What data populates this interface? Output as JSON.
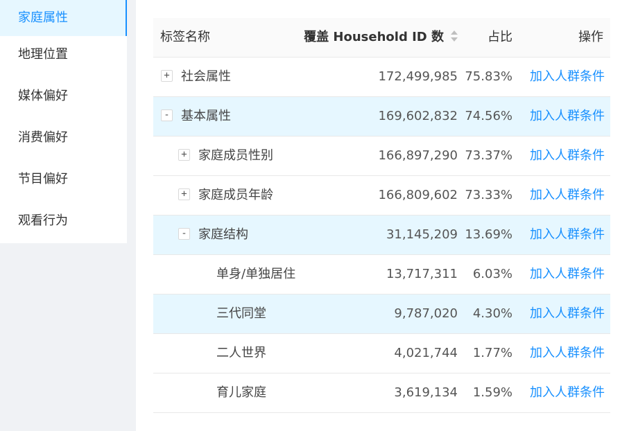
{
  "sidebar": {
    "items": [
      {
        "label": "家庭属性",
        "active": true
      },
      {
        "label": "地理位置"
      },
      {
        "label": "媒体偏好"
      },
      {
        "label": "消费偏好"
      },
      {
        "label": "节目偏好"
      },
      {
        "label": "观看行为"
      }
    ]
  },
  "table": {
    "headers": {
      "name": "标签名称",
      "count": "覆盖 Household ID 数",
      "pct": "占比",
      "op": "操作"
    },
    "rows": [
      {
        "expander": "+",
        "name": "社会属性",
        "count": "172,499,985",
        "pct": "75.83%",
        "op": "加入人群条件"
      },
      {
        "expander": "-",
        "name": "基本属性",
        "count": "169,602,832",
        "pct": "74.56%",
        "op": "加入人群条件"
      },
      {
        "expander": "+",
        "name": "家庭成员性别",
        "count": "166,897,290",
        "pct": "73.37%",
        "op": "加入人群条件"
      },
      {
        "expander": "+",
        "name": "家庭成员年龄",
        "count": "166,809,602",
        "pct": "73.33%",
        "op": "加入人群条件"
      },
      {
        "expander": "-",
        "name": "家庭结构",
        "count": "31,145,209",
        "pct": "13.69%",
        "op": "加入人群条件"
      },
      {
        "name": "单身/单独居住",
        "count": "13,717,311",
        "pct": "6.03%",
        "op": "加入人群条件"
      },
      {
        "name": "三代同堂",
        "count": "9,787,020",
        "pct": "4.30%",
        "op": "加入人群条件"
      },
      {
        "name": "二人世界",
        "count": "4,021,744",
        "pct": "1.77%",
        "op": "加入人群条件"
      },
      {
        "name": "育儿家庭",
        "count": "3,619,134",
        "pct": "1.59%",
        "op": "加入人群条件"
      }
    ]
  },
  "colors": {
    "accent": "#1890ff",
    "highlight_row": "#e6f7ff",
    "sidebar_bg": "#ffffff",
    "page_bg": "#f0f2f5"
  }
}
